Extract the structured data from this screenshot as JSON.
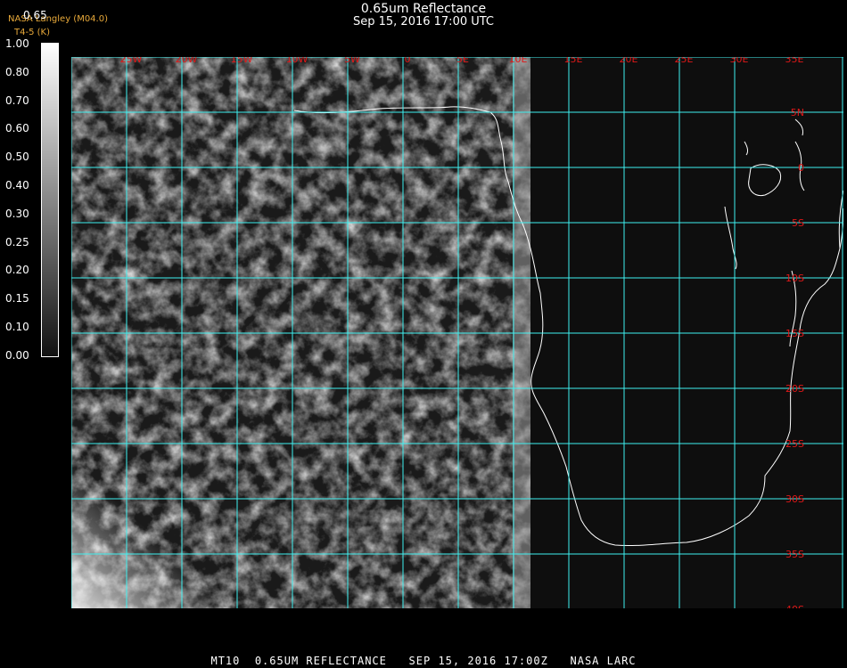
{
  "header": {
    "title": "0.65um Reflectance",
    "subtitle": "Sep 15, 2016 17:00 UTC",
    "brand_line1": "NASA Langley (M04.0)",
    "brand_line2": "T4-5 (K)",
    "scale_title": "0.65"
  },
  "colorbar": {
    "ticks": [
      "1.00",
      "0.80",
      "0.70",
      "0.60",
      "0.50",
      "0.40",
      "0.30",
      "0.25",
      "0.20",
      "0.15",
      "0.10",
      "0.00"
    ]
  },
  "map": {
    "lon_labels": [
      "25W",
      "20W",
      "15W",
      "10W",
      "5W",
      "0",
      "5E",
      "10E",
      "15E",
      "20E",
      "25E",
      "30E",
      "35E"
    ],
    "lat_labels": [
      "5N",
      "0",
      "5S",
      "10S",
      "15S",
      "20S",
      "25S",
      "30S",
      "35S",
      "40S"
    ],
    "grid_color": "#3ff0f0",
    "label_color": "#e01818",
    "coast_color": "#ffffff"
  },
  "footer": {
    "text": "MT10  0.65UM REFLECTANCE   SEP 15, 2016 17:00Z   NASA LARC"
  }
}
